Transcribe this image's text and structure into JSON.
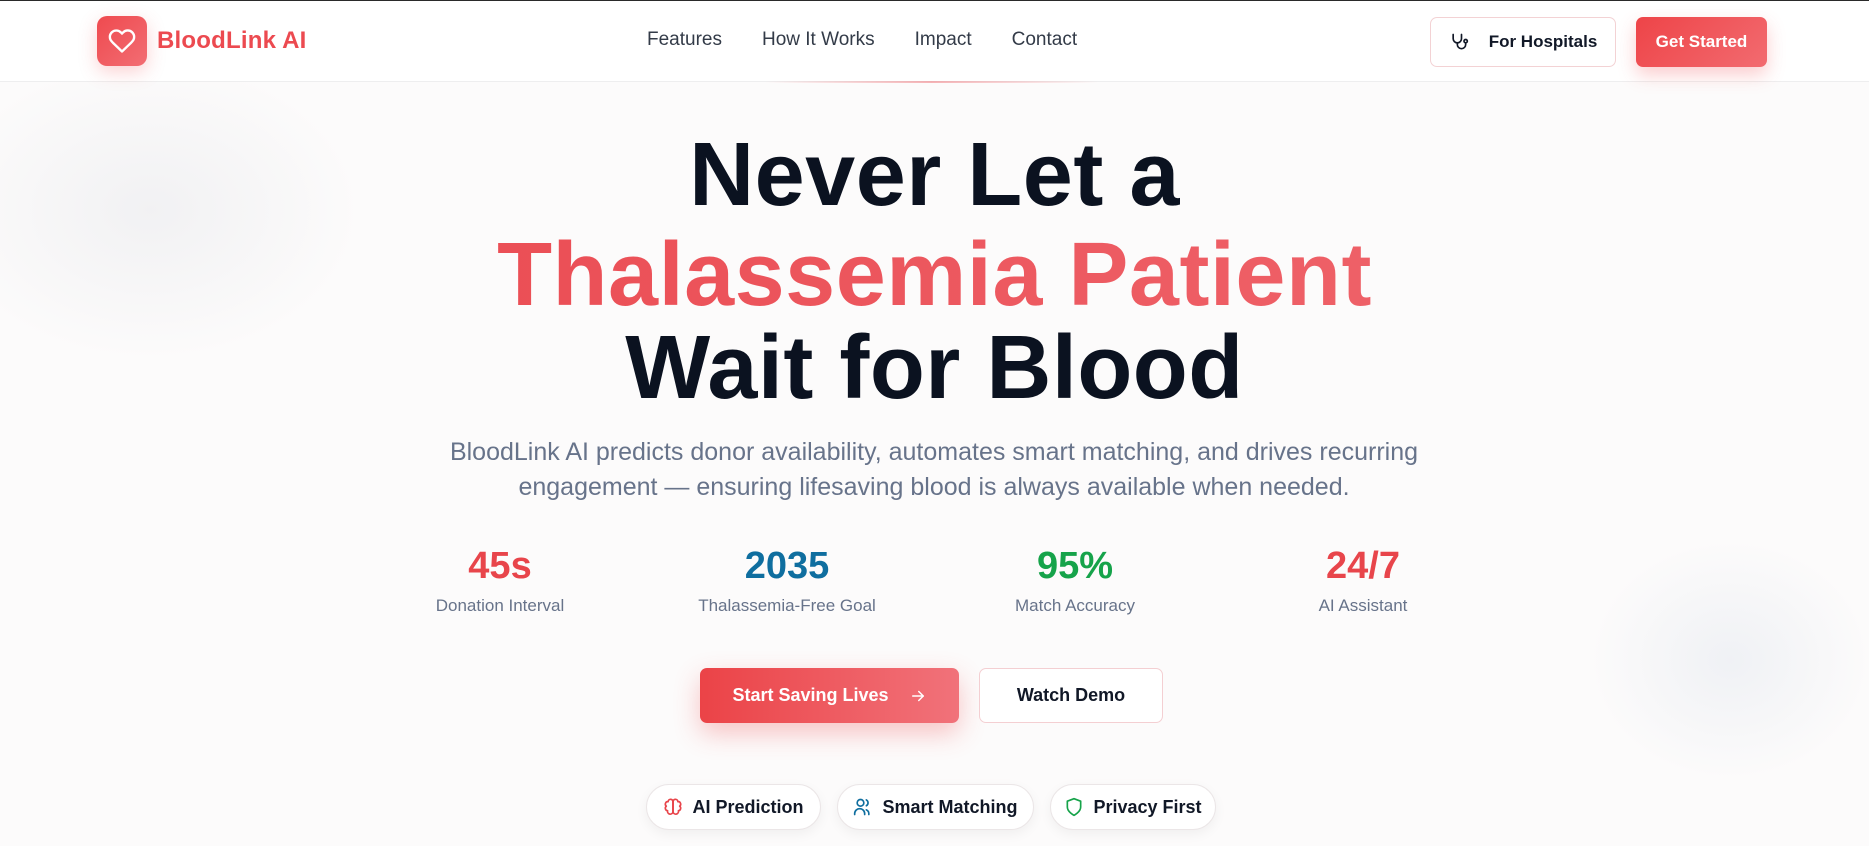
{
  "brand": {
    "name": "BloodLink AI",
    "logo_icon": "heart-icon",
    "color": "#ec4a50"
  },
  "nav": {
    "links": [
      "Features",
      "How It Works",
      "Impact",
      "Contact"
    ],
    "hospitals_label": "For Hospitals",
    "hospitals_icon": "stethoscope-icon",
    "get_started_label": "Get Started"
  },
  "hero": {
    "line1": "Never Let a",
    "line2": "Thalassemia Patient",
    "line3": "Wait for Blood",
    "subtitle": "BloodLink AI predicts donor availability, automates smart matching, and drives recurring engagement — ensuring lifesaving blood is always available when needed.",
    "accent_color": "#ee4b52"
  },
  "stats": [
    {
      "value": "45s",
      "label": "Donation Interval",
      "color": "#e8454b"
    },
    {
      "value": "2035",
      "label": "Thalassemia-Free Goal",
      "color": "#0f6e9f"
    },
    {
      "value": "95%",
      "label": "Match Accuracy",
      "color": "#16a34a"
    },
    {
      "value": "24/7",
      "label": "AI Assistant",
      "color": "#e8454b"
    }
  ],
  "cta": {
    "primary_label": "Start Saving Lives",
    "primary_icon": "arrow-right-icon",
    "secondary_label": "Watch Demo"
  },
  "features": [
    {
      "label": "AI Prediction",
      "icon": "brain-icon",
      "color": "#e8454b"
    },
    {
      "label": "Smart Matching",
      "icon": "users-icon",
      "color": "#0f6e9f"
    },
    {
      "label": "Privacy First",
      "icon": "shield-icon",
      "color": "#16a34a"
    }
  ]
}
